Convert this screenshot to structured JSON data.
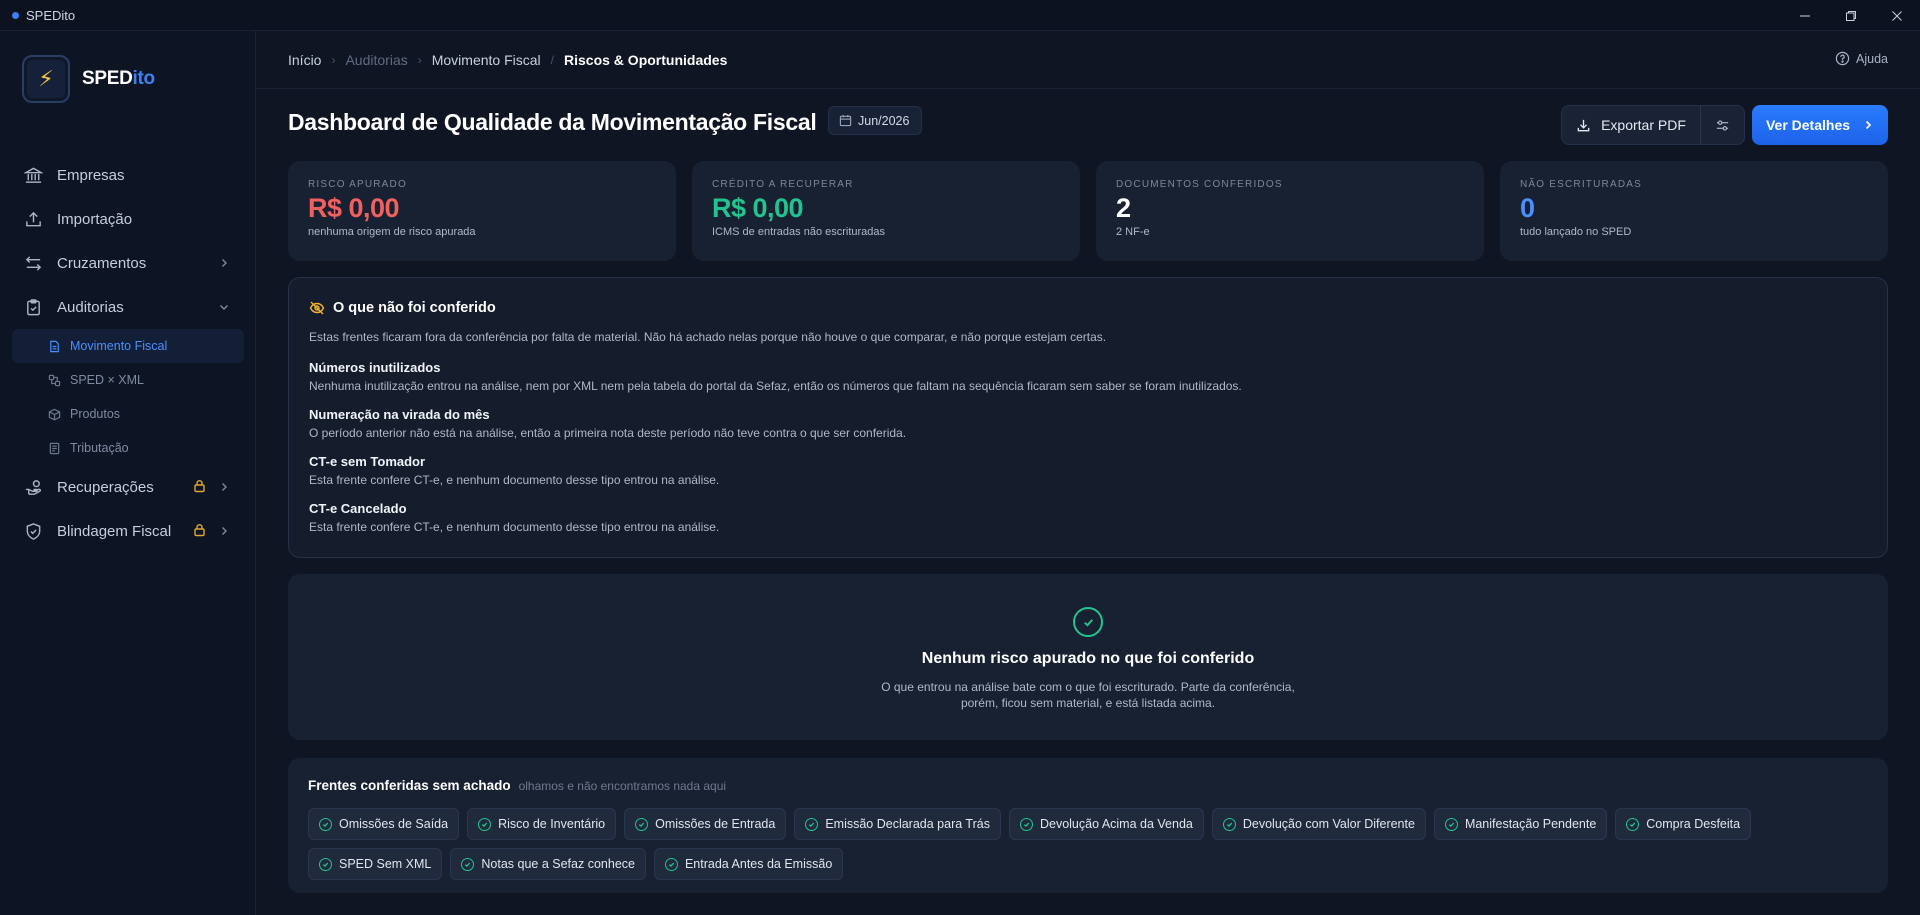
{
  "window": {
    "title": "SPEDito"
  },
  "brand": {
    "name_main": "SPED",
    "name_accent": "ito"
  },
  "sidebar": {
    "items": [
      {
        "label": "Empresas"
      },
      {
        "label": "Importação"
      },
      {
        "label": "Cruzamentos"
      },
      {
        "label": "Auditorias"
      },
      {
        "label": "Recuperações"
      },
      {
        "label": "Blindagem Fiscal"
      }
    ],
    "subitems": [
      {
        "label": "Movimento Fiscal",
        "active": true
      },
      {
        "label": "SPED × XML"
      },
      {
        "label": "Produtos"
      },
      {
        "label": "Tributação"
      }
    ]
  },
  "breadcrumb": [
    "Início",
    "Auditorias",
    "Movimento Fiscal",
    "Riscos & Oportunidades"
  ],
  "help_label": "Ajuda",
  "header": {
    "title": "Dashboard de Qualidade da Movimentação Fiscal",
    "period": "Jun/2026",
    "export_label": "Exportar PDF",
    "details_label": "Ver Detalhes"
  },
  "kpis": [
    {
      "label": "RISCO APURADO",
      "value": "R$ 0,00",
      "sub": "nenhuma origem de risco apurada",
      "color": "#f0605e"
    },
    {
      "label": "CRÉDITO A RECUPERAR",
      "value": "R$ 0,00",
      "sub": "ICMS de entradas não escrituradas",
      "color": "#22c38e"
    },
    {
      "label": "DOCUMENTOS CONFERIDOS",
      "value": "2",
      "sub": "2 NF-e",
      "color": "#ffffff"
    },
    {
      "label": "NÃO ESCRITURADAS",
      "value": "0",
      "sub": "tudo lançado no SPED",
      "color": "#4c8dff"
    }
  ],
  "not_verified": {
    "title": "O que não foi conferido",
    "description": "Estas frentes ficaram fora da conferência por falta de material. Não há achado nelas porque não houve o que comparar, e não porque estejam certas.",
    "items": [
      {
        "title": "Números inutilizados",
        "text": "Nenhuma inutilização entrou na análise, nem por XML nem pela tabela do portal da Sefaz, então os números que faltam na sequência ficaram sem saber se foram inutilizados."
      },
      {
        "title": "Numeração na virada do mês",
        "text": "O período anterior não está na análise, então a primeira nota deste período não teve contra o que ser conferida."
      },
      {
        "title": "CT-e sem Tomador",
        "text": "Esta frente confere CT-e, e nenhum documento desse tipo entrou na análise."
      },
      {
        "title": "CT-e Cancelado",
        "text": "Esta frente confere CT-e, e nenhum documento desse tipo entrou na análise."
      }
    ]
  },
  "no_risk": {
    "title": "Nenhum risco apurado no que foi conferido",
    "line1": "O que entrou na análise bate com o que foi escriturado. Parte da conferência,",
    "line2": "porém, ficou sem material, e está listada acima."
  },
  "fronts": {
    "title": "Frentes conferidas sem achado",
    "subtitle": "olhamos e não encontramos nada aqui",
    "chips": [
      "Omissões de Saída",
      "Risco de Inventário",
      "Omissões de Entrada",
      "Emissão Declarada para Trás",
      "Devolução Acima da Venda",
      "Devolução com Valor Diferente",
      "Manifestação Pendente",
      "Compra Desfeita",
      "SPED Sem XML",
      "Notas que a Sefaz conhece",
      "Entrada Antes da Emissão"
    ]
  }
}
